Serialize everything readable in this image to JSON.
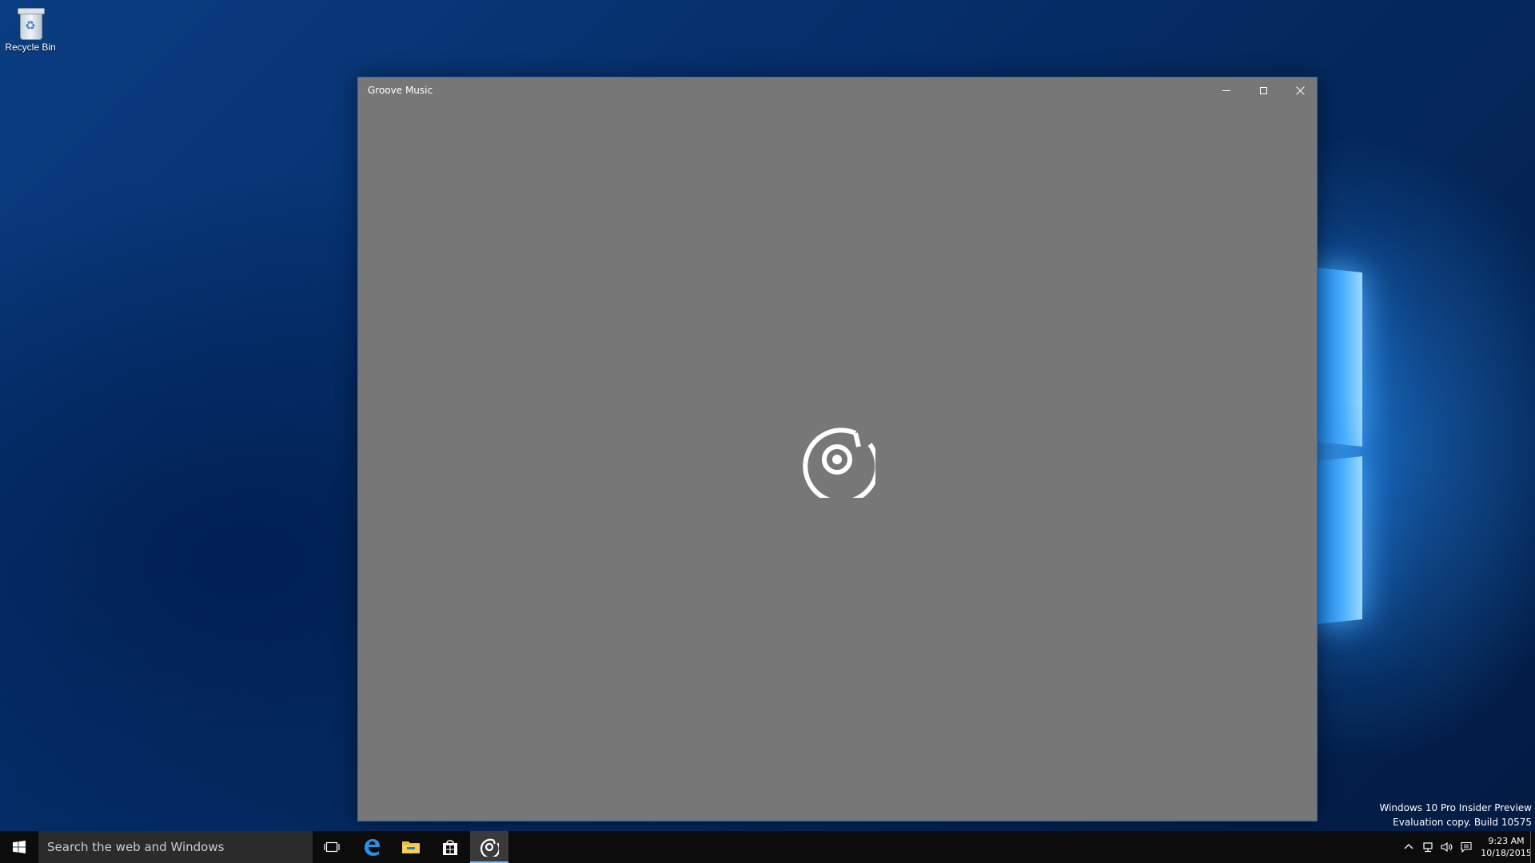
{
  "desktop": {
    "icons": [
      {
        "label": "Recycle Bin",
        "icon": "recycle-bin-icon"
      }
    ],
    "watermark": {
      "line1": "Windows 10 Pro Insider Preview",
      "line2": "Evaluation copy. Build 10575"
    }
  },
  "window": {
    "title": "Groove Music",
    "controls": {
      "minimize": "minimize-icon",
      "maximize": "maximize-icon",
      "close": "close-icon"
    },
    "background_color": "#777777",
    "splash_icon": "groove-music-logo-icon"
  },
  "taskbar": {
    "search_placeholder": "Search the web and Windows",
    "pinned": [
      {
        "name": "task-view",
        "icon": "task-view-icon"
      },
      {
        "name": "edge",
        "icon": "edge-icon"
      },
      {
        "name": "file-explorer",
        "icon": "folder-icon"
      },
      {
        "name": "store",
        "icon": "store-icon"
      },
      {
        "name": "groove-music",
        "icon": "groove-music-icon",
        "active": true
      }
    ],
    "tray": {
      "icons": [
        "chevron-up-icon",
        "network-icon",
        "volume-icon",
        "action-center-icon"
      ],
      "time": "9:23 AM",
      "date": "10/18/2015"
    },
    "background_color": "#0c0c0c",
    "accent_color": "#7ab8f5"
  }
}
